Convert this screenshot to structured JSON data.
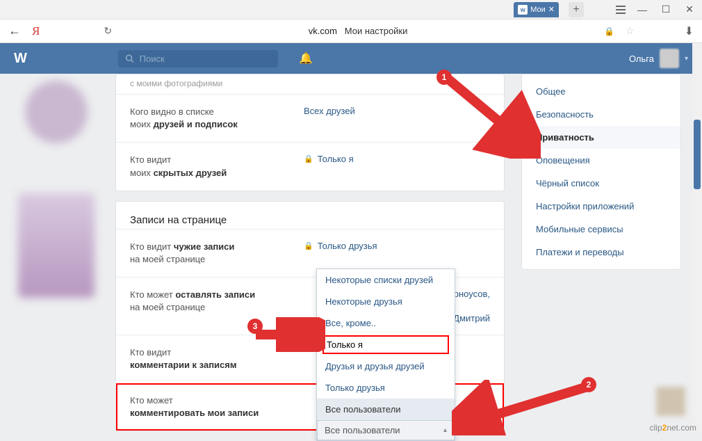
{
  "browser": {
    "tab_label": "Мои",
    "domain": "vk.com",
    "title": "Мои настройки"
  },
  "header": {
    "search_placeholder": "Поиск",
    "username": "Ольга"
  },
  "card1": {
    "row0_cut": "с моими фотографиями",
    "row1_label_a": "Кого видно в списке",
    "row1_label_b": "моих",
    "row1_label_c": "друзей и подписок",
    "row1_value": "Всех друзей",
    "row2_label_a": "Кто видит",
    "row2_label_b": "моих",
    "row2_label_c": "скрытых друзей",
    "row2_value": "Только я"
  },
  "section2_title": "Записи на странице",
  "card2": {
    "r1_a": "Кто видит",
    "r1_b": "чужие записи",
    "r1_c": "на моей странице",
    "r1_val": "Только друзья",
    "r2_a": "Кто может",
    "r2_b": "оставлять записи",
    "r2_c": "на моей странице",
    "r2_val_frag1": "рноусов,",
    "r2_val_frag2": "в, Дмитрий",
    "r3_a": "Кто видит",
    "r3_b": "комментарии к записям",
    "r4_a": "Кто может",
    "r4_b": "комментировать мои записи"
  },
  "dropdown": {
    "items": [
      "Некоторые списки друзей",
      "Некоторые друзья",
      "Все, кроме..",
      "Только я",
      "Друзья и друзья друзей",
      "Только друзья",
      "Все пользователи"
    ],
    "current": "Все пользователи"
  },
  "sidebar": {
    "items": [
      "Общее",
      "Безопасность",
      "Приватность",
      "Оповещения",
      "Чёрный список",
      "Настройки приложений",
      "Мобильные сервисы",
      "Платежи и переводы"
    ],
    "active_index": 2
  },
  "callouts": {
    "c1": "1",
    "c2": "2",
    "c3": "3"
  },
  "watermark_a": "clip",
  "watermark_b": "2",
  "watermark_c": "net.com"
}
